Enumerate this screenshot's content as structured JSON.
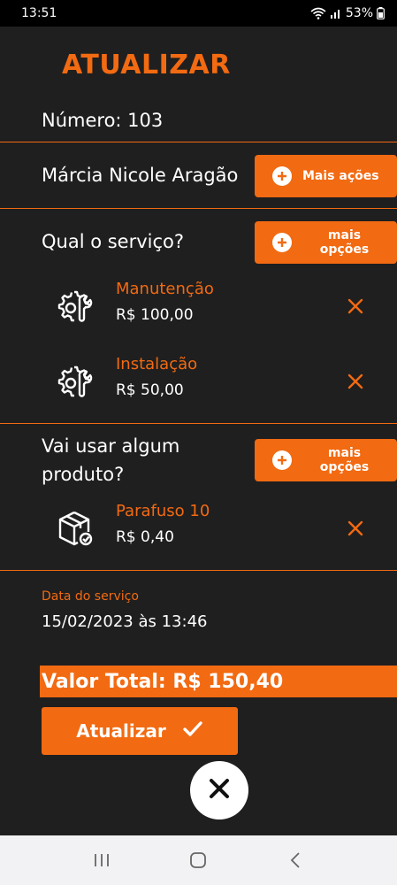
{
  "status_bar": {
    "time": "13:51",
    "battery": "53%"
  },
  "page": {
    "title": "ATUALIZAR",
    "numero_label": "Número: 103",
    "client_name": "Márcia Nicole Aragão",
    "more_actions_label": "Mais ações"
  },
  "services": {
    "question": "Qual o serviço?",
    "more_options_label": "mais opções",
    "items": [
      {
        "name": "Manutenção",
        "price": "R$ 100,00"
      },
      {
        "name": "Instalação",
        "price": "R$ 50,00"
      }
    ]
  },
  "products": {
    "question_line1": "Vai usar algum",
    "question_line2": "produto?",
    "more_options_label": "mais opções",
    "items": [
      {
        "name": "Parafuso 10",
        "price": "R$ 0,40"
      }
    ]
  },
  "date": {
    "label": "Data do serviço",
    "value": "15/02/2023 às 13:46"
  },
  "total": {
    "text": "Valor Total: R$ 150,40"
  },
  "actions": {
    "update_label": "Atualizar"
  },
  "colors": {
    "accent": "#f26a12",
    "background": "#1f1f1f"
  }
}
